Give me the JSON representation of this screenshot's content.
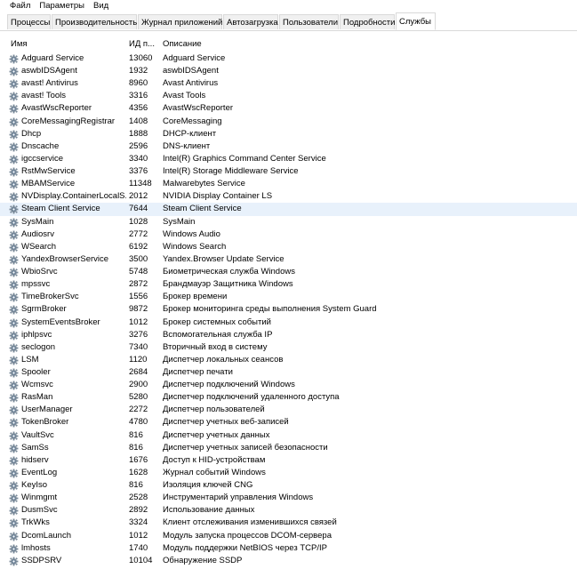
{
  "menu": [
    "Файл",
    "Параметры",
    "Вид"
  ],
  "tabs": [
    {
      "label": "Процессы",
      "active": false
    },
    {
      "label": "Производительность",
      "active": false
    },
    {
      "label": "Журнал приложений",
      "active": false
    },
    {
      "label": "Автозагрузка",
      "active": false
    },
    {
      "label": "Пользователи",
      "active": false
    },
    {
      "label": "Подробности",
      "active": false
    },
    {
      "label": "Службы",
      "active": true
    }
  ],
  "columns": {
    "name": "Имя",
    "pid": "ИД п...",
    "description": "Описание"
  },
  "selected_row": "Steam Client Service",
  "services": [
    {
      "name": "Adguard Service",
      "pid": "13060",
      "description": "Adguard Service"
    },
    {
      "name": "aswbIDSAgent",
      "pid": "1932",
      "description": "aswbIDSAgent"
    },
    {
      "name": "avast! Antivirus",
      "pid": "8960",
      "description": "Avast Antivirus"
    },
    {
      "name": "avast! Tools",
      "pid": "3316",
      "description": "Avast Tools"
    },
    {
      "name": "AvastWscReporter",
      "pid": "4356",
      "description": "AvastWscReporter"
    },
    {
      "name": "CoreMessagingRegistrar",
      "pid": "1408",
      "description": "CoreMessaging"
    },
    {
      "name": "Dhcp",
      "pid": "1888",
      "description": "DHCP-клиент"
    },
    {
      "name": "Dnscache",
      "pid": "2596",
      "description": "DNS-клиент"
    },
    {
      "name": "igccservice",
      "pid": "3340",
      "description": "Intel(R) Graphics Command Center Service"
    },
    {
      "name": "RstMwService",
      "pid": "3376",
      "description": "Intel(R) Storage Middleware Service"
    },
    {
      "name": "MBAMService",
      "pid": "11348",
      "description": "Malwarebytes Service"
    },
    {
      "name": "NVDisplay.ContainerLocalS...",
      "pid": "2012",
      "description": "NVIDIA Display Container LS"
    },
    {
      "name": "Steam Client Service",
      "pid": "7644",
      "description": "Steam Client Service"
    },
    {
      "name": "SysMain",
      "pid": "1028",
      "description": "SysMain"
    },
    {
      "name": "Audiosrv",
      "pid": "2772",
      "description": "Windows Audio"
    },
    {
      "name": "WSearch",
      "pid": "6192",
      "description": "Windows Search"
    },
    {
      "name": "YandexBrowserService",
      "pid": "3500",
      "description": "Yandex.Browser Update Service"
    },
    {
      "name": "WbioSrvc",
      "pid": "5748",
      "description": "Биометрическая служба Windows"
    },
    {
      "name": "mpssvc",
      "pid": "2872",
      "description": "Брандмауэр Защитника Windows"
    },
    {
      "name": "TimeBrokerSvc",
      "pid": "1556",
      "description": "Брокер времени"
    },
    {
      "name": "SgrmBroker",
      "pid": "9872",
      "description": "Брокер мониторинга среды выполнения System Guard"
    },
    {
      "name": "SystemEventsBroker",
      "pid": "1012",
      "description": "Брокер системных событий"
    },
    {
      "name": "iphlpsvc",
      "pid": "3276",
      "description": "Вспомогательная служба IP"
    },
    {
      "name": "seclogon",
      "pid": "7340",
      "description": "Вторичный вход в систему"
    },
    {
      "name": "LSM",
      "pid": "1120",
      "description": "Диспетчер локальных сеансов"
    },
    {
      "name": "Spooler",
      "pid": "2684",
      "description": "Диспетчер печати"
    },
    {
      "name": "Wcmsvc",
      "pid": "2900",
      "description": "Диспетчер подключений Windows"
    },
    {
      "name": "RasMan",
      "pid": "5280",
      "description": "Диспетчер подключений удаленного доступа"
    },
    {
      "name": "UserManager",
      "pid": "2272",
      "description": "Диспетчер пользователей"
    },
    {
      "name": "TokenBroker",
      "pid": "4780",
      "description": "Диспетчер учетных веб-записей"
    },
    {
      "name": "VaultSvc",
      "pid": "816",
      "description": "Диспетчер учетных данных"
    },
    {
      "name": "SamSs",
      "pid": "816",
      "description": "Диспетчер учетных записей безопасности"
    },
    {
      "name": "hidserv",
      "pid": "1676",
      "description": "Доступ к HID-устройствам"
    },
    {
      "name": "EventLog",
      "pid": "1628",
      "description": "Журнал событий Windows"
    },
    {
      "name": "KeyIso",
      "pid": "816",
      "description": "Изоляция ключей CNG"
    },
    {
      "name": "Winmgmt",
      "pid": "2528",
      "description": "Инструментарий управления Windows"
    },
    {
      "name": "DusmSvc",
      "pid": "2892",
      "description": "Использование данных"
    },
    {
      "name": "TrkWks",
      "pid": "3324",
      "description": "Клиент отслеживания изменившихся связей"
    },
    {
      "name": "DcomLaunch",
      "pid": "1012",
      "description": "Модуль запуска процессов DCOM-сервера"
    },
    {
      "name": "lmhosts",
      "pid": "1740",
      "description": "Модуль поддержки NetBIOS через TCP/IP"
    },
    {
      "name": "SSDPSRV",
      "pid": "10104",
      "description": "Обнаружение SSDP"
    }
  ]
}
